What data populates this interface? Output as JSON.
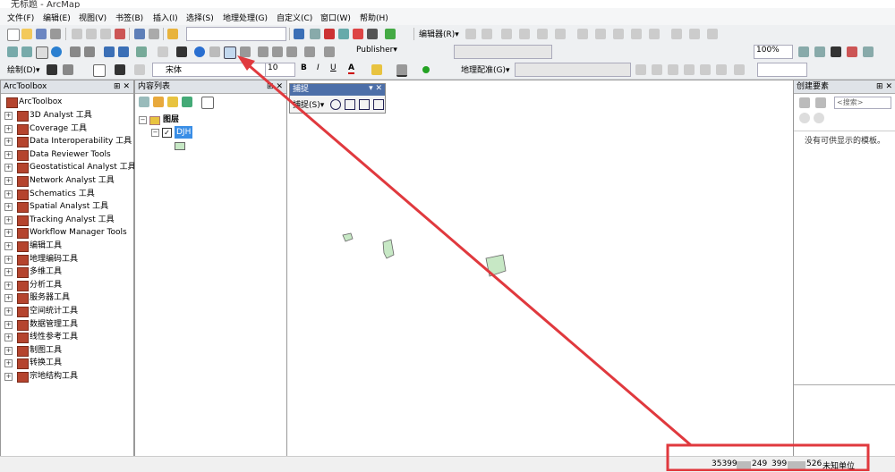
{
  "window": {
    "title": "无标题 - ArcMap"
  },
  "menu": [
    "文件(F)",
    "编辑(E)",
    "视图(V)",
    "书签(B)",
    "插入(I)",
    "选择(S)",
    "地理处理(G)",
    "自定义(C)",
    "窗口(W)",
    "帮助(H)"
  ],
  "toolbar1": {
    "editor_label": "编辑器(R)▾"
  },
  "toolbar2": {
    "publisher_label": "Publisher▾",
    "zoom_value": "100%"
  },
  "toolbar3": {
    "draw_label": "绘制(D)▾",
    "font_name": "宋体",
    "font_size": "10",
    "bold": "B",
    "italic": "I",
    "underline": "U",
    "font_color": "A",
    "georef_label": "地理配准(G)▾"
  },
  "arctoolbox": {
    "title": "ArcToolbox",
    "root": "ArcToolbox",
    "items": [
      "3D Analyst 工具",
      "Coverage 工具",
      "Data Interoperability 工具",
      "Data Reviewer Tools",
      "Geostatistical Analyst 工具",
      "Network Analyst 工具",
      "Schematics 工具",
      "Spatial Analyst 工具",
      "Tracking Analyst 工具",
      "Workflow Manager Tools",
      "编辑工具",
      "地理编码工具",
      "多维工具",
      "分析工具",
      "服务器工具",
      "空间统计工具",
      "数据管理工具",
      "线性参考工具",
      "制图工具",
      "转换工具",
      "宗地结构工具"
    ]
  },
  "toc": {
    "title": "内容列表",
    "layers_label": "图层",
    "layer_name": "DJH"
  },
  "snapping": {
    "title": "捕捉",
    "menu_label": "捕捉(S)▾"
  },
  "create_features": {
    "title": "创建要素",
    "search_placeholder": "<搜索>",
    "empty_msg": "没有可供显示的模板。"
  },
  "status": {
    "coord_x_prefix": "35399",
    "coord_x_suffix": "249",
    "coord_y_prefix": "399",
    "coord_y_suffix": "526",
    "units": "未知单位"
  },
  "colors": {
    "feature_fill": "#c7e8c5",
    "annotation_red": "#e0393e",
    "toolbox_red": "#b5442e"
  }
}
